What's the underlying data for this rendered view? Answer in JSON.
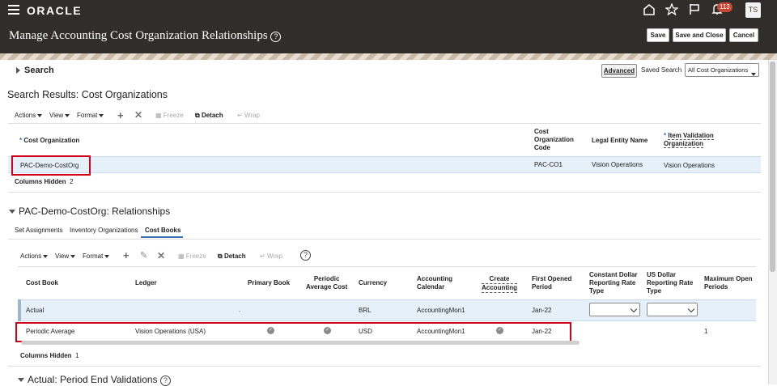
{
  "header": {
    "brand": "ORACLE",
    "notification_count": "113",
    "user_initials": "TS"
  },
  "page": {
    "title": "Manage Accounting Cost Organization Relationships",
    "help": "?",
    "buttons": {
      "save": "Save",
      "save_close": "Save and Close",
      "cancel": "Cancel"
    }
  },
  "search": {
    "label": "Search",
    "advanced": "Advanced",
    "saved_search_label": "Saved Search",
    "saved_search_value": "All Cost Organizations"
  },
  "results": {
    "title": "Search Results: Cost Organizations",
    "toolbar": {
      "actions": "Actions",
      "view": "View",
      "format": "Format",
      "freeze": "Freeze",
      "detach": "Detach",
      "wrap": "Wrap"
    },
    "columns": {
      "cost_org": "Cost Organization",
      "code_l1": "Cost",
      "code_l2": "Organization",
      "code_l3": "Code",
      "legal_entity": "Legal Entity Name",
      "ivo_l1": "Item Validation",
      "ivo_l2": "Organization",
      "required": "*"
    },
    "rows": [
      {
        "cost_org": "PAC-Demo-CostOrg",
        "code": "PAC-CO1",
        "legal_entity": "Vision Operations",
        "ivo": "Vision Operations"
      }
    ],
    "columns_hidden_label": "Columns Hidden",
    "columns_hidden_count": "2"
  },
  "relationships": {
    "title": "PAC-Demo-CostOrg: Relationships",
    "tabs": [
      "Set Assignments",
      "Inventory Organizations",
      "Cost Books"
    ],
    "active_tab": "Cost Books",
    "toolbar": {
      "actions": "Actions",
      "view": "View",
      "format": "Format",
      "freeze": "Freeze",
      "detach": "Detach",
      "wrap": "Wrap",
      "help": "?"
    },
    "columns": {
      "cost_book": "Cost Book",
      "ledger": "Ledger",
      "primary_book": "Primary Book",
      "pac_l1": "Periodic",
      "pac_l2": "Average Cost",
      "currency": "Currency",
      "cal_l1": "Accounting",
      "cal_l2": "Calendar",
      "ca_l1": "Create",
      "ca_l2": "Accounting",
      "fop_l1": "First Opened",
      "fop_l2": "Period",
      "cd_l1": "Constant Dollar",
      "cd_l2": "Reporting Rate",
      "cd_l3": "Type",
      "usd_l1": "US Dollar",
      "usd_l2": "Reporting Rate",
      "usd_l3": "Type",
      "mop_l1": "Maximum Open",
      "mop_l2": "Periods"
    },
    "rows": [
      {
        "cost_book": "Actual",
        "ledger": "",
        "primary": ".",
        "currency": "BRL",
        "calendar": "AccountingMon1",
        "first_period": "Jan-22",
        "max_open": ""
      },
      {
        "cost_book": "Periodic Average",
        "ledger": "Vision Operations (USA)",
        "currency": "USD",
        "calendar": "AccountingMon1",
        "first_period": "Jan-22",
        "max_open": "1"
      }
    ],
    "columns_hidden_label": "Columns Hidden",
    "columns_hidden_count": "1"
  },
  "validations": {
    "title": "Actual: Period End Validations"
  }
}
